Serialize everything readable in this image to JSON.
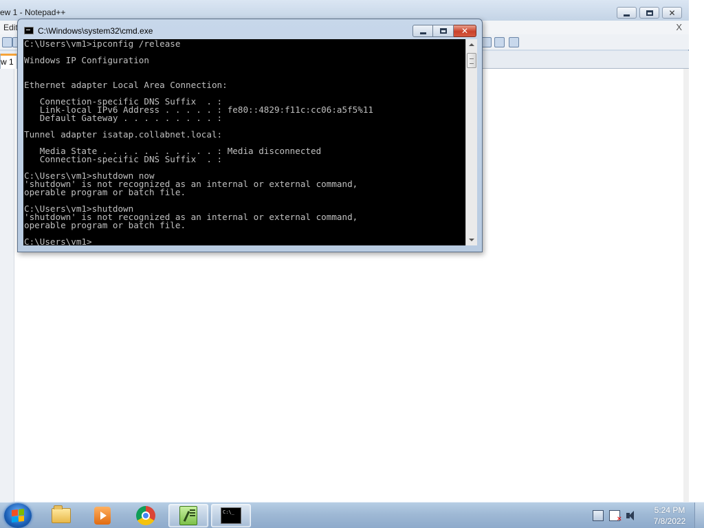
{
  "notepadpp": {
    "title": "ew 1 - Notepad++",
    "menu_partial": "Edit",
    "close_doc": "X",
    "tab_partial": "w 1"
  },
  "cmd": {
    "title": "C:\\Windows\\system32\\cmd.exe",
    "lines": [
      "C:\\Users\\vm1>ipconfig /release",
      "",
      "Windows IP Configuration",
      "",
      "",
      "Ethernet adapter Local Area Connection:",
      "",
      "   Connection-specific DNS Suffix  . :",
      "   Link-local IPv6 Address . . . . . : fe80::4829:f11c:cc06:a5f5%11",
      "   Default Gateway . . . . . . . . . :",
      "",
      "Tunnel adapter isatap.collabnet.local:",
      "",
      "   Media State . . . . . . . . . . . : Media disconnected",
      "   Connection-specific DNS Suffix  . :",
      "",
      "C:\\Users\\vm1>shutdown now",
      "'shutdown' is not recognized as an internal or external command,",
      "operable program or batch file.",
      "",
      "C:\\Users\\vm1>shutdown",
      "'shutdown' is not recognized as an internal or external command,",
      "operable program or batch file.",
      "",
      "C:\\Users\\vm1>"
    ]
  },
  "taskbar": {
    "items": [
      {
        "name": "windows-explorer",
        "icon": "folder-icon"
      },
      {
        "name": "windows-media-player",
        "icon": "media-player-icon"
      },
      {
        "name": "google-chrome",
        "icon": "chrome-icon"
      },
      {
        "name": "notepad-plus-plus",
        "icon": "notepadpp-icon"
      },
      {
        "name": "command-prompt",
        "icon": "cmd-icon"
      }
    ],
    "tray_icons": [
      "network-icon",
      "action-center-icon",
      "volume-icon"
    ],
    "time": "5:24 PM",
    "date": "7/8/2022"
  },
  "colors": {
    "console_bg": "#000000",
    "console_fg": "#c0c0c0",
    "close_button": "#c9422c",
    "taskbar": "#9fb9d5"
  }
}
